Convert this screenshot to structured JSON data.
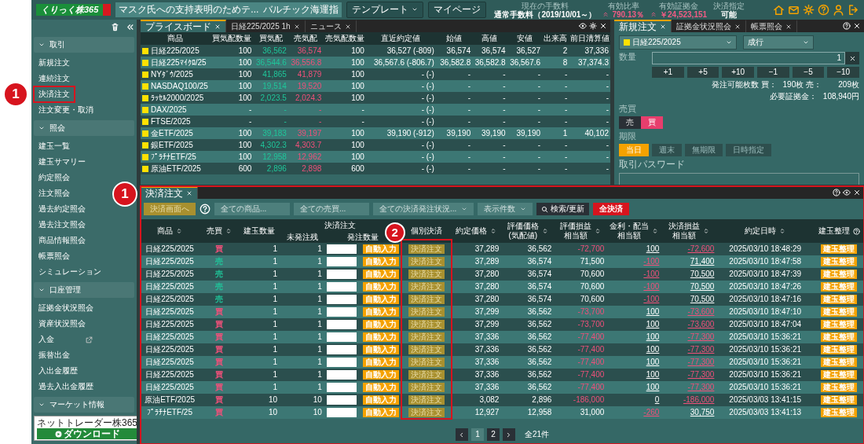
{
  "header": {
    "logo": "くりっく株365",
    "news": [
      "マスク氏への支持表明のためテ...",
      "バルチック海運指"
    ],
    "buttons": [
      {
        "label": "テンプレート",
        "dropdown": true
      },
      {
        "label": "マイページ",
        "dropdown": false
      }
    ],
    "stats": [
      {
        "label": "現在の手数料",
        "value": "通常手数料（2019/10/01～）",
        "rising": false
      },
      {
        "label": "有効比率",
        "value": "790.13％",
        "rising": true
      },
      {
        "label": "有効証拠金",
        "value": "￥24,523,151",
        "rising": true
      },
      {
        "label": "決済指定",
        "value": "可能",
        "rising": false
      }
    ]
  },
  "sidebar": {
    "sections": [
      {
        "title": "取引",
        "expanded": true,
        "items": [
          {
            "label": "新規注文"
          },
          {
            "label": "連続注文"
          },
          {
            "label": "決済注文",
            "marker": "1"
          },
          {
            "label": "注文変更・取消"
          }
        ]
      },
      {
        "title": "照会",
        "expanded": true,
        "items": [
          {
            "label": "建玉一覧"
          },
          {
            "label": "建玉サマリー"
          },
          {
            "label": "約定照会"
          },
          {
            "label": "注文照会"
          },
          {
            "label": "過去約定照会"
          },
          {
            "label": "過去注文照会"
          },
          {
            "label": "商品情報照会"
          },
          {
            "label": "帳票照会"
          },
          {
            "label": "シミュレーション"
          }
        ]
      },
      {
        "title": "口座管理",
        "expanded": true,
        "items": [
          {
            "label": "証拠金状況照会"
          },
          {
            "label": "資産状況照会"
          },
          {
            "label": "入金",
            "external": true
          },
          {
            "label": "振替出金"
          },
          {
            "label": "入出金履歴"
          },
          {
            "label": "過去入出金履歴"
          }
        ]
      },
      {
        "title": "マーケット情報",
        "expanded": true
      }
    ],
    "download": [
      "ネットトレーダー株365",
      "ダウンロード"
    ]
  },
  "price_board": {
    "tabs": [
      {
        "label": "プライスボード",
        "selected": true
      },
      {
        "label": "日経225/2025 1h",
        "selected": false
      },
      {
        "label": "ニュース",
        "selected": false
      }
    ],
    "columns": [
      "商品",
      "買気配数量",
      "買気配",
      "売気配",
      "売気配数量",
      "直近約定値",
      "始値",
      "高値",
      "安値",
      "出来高",
      "前日清算値"
    ],
    "rows": [
      [
        "日経225/2025",
        "100",
        "36,562",
        "36,574",
        "100",
        "36,527 (-809)",
        "36,574",
        "36,574",
        "36,527",
        "2",
        "37,336"
      ],
      [
        "日経225ﾏｲｸﾛ/25",
        "100",
        "36,544.6",
        "36,556.8",
        "100",
        "36,567.6 (-806.7)",
        "36,582.8",
        "36,582.8",
        "36,567.6",
        "8",
        "37,374.3"
      ],
      [
        "NYﾀﾞｳ/2025",
        "100",
        "41,865",
        "41,879",
        "100",
        "- (-)",
        "-",
        "-",
        "-",
        "-",
        "-"
      ],
      [
        "NASDAQ100/25",
        "100",
        "19,514",
        "19,520",
        "100",
        "- (-)",
        "-",
        "-",
        "-",
        "-",
        "-"
      ],
      [
        "ﾗｯｾﾙ2000/2025",
        "100",
        "2,023.5",
        "2,024.3",
        "100",
        "- (-)",
        "-",
        "-",
        "-",
        "-",
        "-"
      ],
      [
        "DAX/2025",
        "-",
        "-",
        "-",
        "-",
        "- (-)",
        "-",
        "-",
        "-",
        "-",
        "-"
      ],
      [
        "FTSE/2025",
        "-",
        "-",
        "-",
        "-",
        "- (-)",
        "-",
        "-",
        "-",
        "-",
        "-"
      ],
      [
        "金ETF/2025",
        "100",
        "39,183",
        "39,197",
        "100",
        "39,190 (-912)",
        "39,190",
        "39,190",
        "39,190",
        "1",
        "40,102"
      ],
      [
        "銀ETF/2025",
        "100",
        "4,302.3",
        "4,303.7",
        "100",
        "- (-)",
        "-",
        "-",
        "-",
        "-",
        "-"
      ],
      [
        "ﾌﾟﾗﾁﾅETF/25",
        "100",
        "12,958",
        "12,962",
        "100",
        "- (-)",
        "-",
        "-",
        "-",
        "-",
        "-"
      ],
      [
        "原油ETF/2025",
        "600",
        "2,896",
        "2,898",
        "600",
        "- (-)",
        "-",
        "-",
        "-",
        "-",
        "-"
      ]
    ]
  },
  "order_panel": {
    "tabs": [
      {
        "label": "新規注文",
        "selected": true
      },
      {
        "label": "証拠金状況照会",
        "selected": false
      },
      {
        "label": "帳票照会",
        "selected": false
      }
    ],
    "product": "日経225/2025",
    "order_type": "成行",
    "quantity_label": "数量",
    "quantity": "1",
    "steps": [
      "+1",
      "+5",
      "+10",
      "−1",
      "−5",
      "−10"
    ],
    "info": [
      [
        "発注可能枚数 買：",
        "190枚 売：",
        "209枚"
      ],
      [
        "必要証拠金：",
        "108,940円"
      ]
    ],
    "side_label": "売買",
    "sides": [
      {
        "label": "売",
        "selected": false,
        "kind": "sell"
      },
      {
        "label": "買",
        "selected": true,
        "kind": "buy"
      }
    ],
    "term_label": "期限",
    "terms": [
      {
        "label": "当日",
        "selected": true
      },
      {
        "label": "週末",
        "selected": false
      },
      {
        "label": "無期限",
        "selected": false
      },
      {
        "label": "日時指定",
        "selected": false
      }
    ],
    "password_label": "取引パスワード"
  },
  "settlement": {
    "tab": "決済注文",
    "marker": "1",
    "toolbar": [
      {
        "kind": "gold",
        "label": "決済画面へ"
      },
      {
        "kind": "help"
      },
      {
        "kind": "filter",
        "label": "全ての商品..."
      },
      {
        "kind": "filter",
        "label": "全ての売買..."
      },
      {
        "kind": "dropdown",
        "label": "全ての決済発注状況..."
      },
      {
        "kind": "dropdown",
        "label": "表示件数"
      },
      {
        "kind": "search",
        "label": "検索/更新"
      },
      {
        "kind": "danger",
        "label": "全決済"
      }
    ],
    "group_header": "決済注文",
    "columns": [
      {
        "lines": [
          "商品"
        ],
        "sortable": true
      },
      {
        "lines": [
          "売買"
        ],
        "sortable": true
      },
      {
        "lines": [
          "建玉数量"
        ],
        "sortable": false
      },
      {
        "lines": [
          "未発注残"
        ],
        "sortable": false
      },
      {
        "lines": [
          "発注数量"
        ],
        "sortable": false
      },
      {
        "lines": [
          "個別決済"
        ],
        "sortable": false,
        "marker": "2"
      },
      {
        "lines": [
          "約定価格"
        ],
        "sortable": true
      },
      {
        "lines": [
          "評価価格",
          "(気配値)"
        ],
        "sortable": true
      },
      {
        "lines": [
          "評価損益",
          "相当額"
        ],
        "sortable": true
      },
      {
        "lines": [
          "金利・配当",
          "相当額"
        ],
        "sortable": true
      },
      {
        "lines": [
          "決済損益",
          "相当額"
        ],
        "sortable": true
      },
      {
        "lines": [
          "約定日時"
        ],
        "sortable": true
      },
      {
        "lines": [
          "建玉整理"
        ],
        "sortable": false,
        "help": true
      }
    ],
    "rows": [
      {
        "product": "日経225/2025",
        "side": {
          "label": "買",
          "kind": "buy"
        },
        "qty": "1",
        "remaining": "1",
        "auto": "自動入力",
        "close": "決済注文",
        "price": "37,289",
        "eval": "36,562",
        "pnl": "-72,700",
        "pnl_negative": true,
        "interest": "100",
        "interest_negative": false,
        "settle": "-72,600",
        "settle_negative": true,
        "time": "2025/03/10 18:48:29",
        "tidy": "建玉整理"
      },
      {
        "product": "日経225/2025",
        "side": {
          "label": "売",
          "kind": "sell"
        },
        "qty": "1",
        "remaining": "1",
        "auto": "自動入力",
        "close": "決済注文",
        "price": "37,289",
        "eval": "36,574",
        "pnl": "71,500",
        "pnl_negative": false,
        "interest": "-100",
        "interest_negative": true,
        "settle": "71,400",
        "settle_negative": false,
        "time": "2025/03/10 18:47:58",
        "tidy": "建玉整理"
      },
      {
        "product": "日経225/2025",
        "side": {
          "label": "売",
          "kind": "sell"
        },
        "qty": "1",
        "remaining": "1",
        "auto": "自動入力",
        "close": "決済注文",
        "price": "37,280",
        "eval": "36,574",
        "pnl": "70,600",
        "pnl_negative": false,
        "interest": "-100",
        "interest_negative": true,
        "settle": "70,500",
        "settle_negative": false,
        "time": "2025/03/10 18:47:39",
        "tidy": "建玉整理"
      },
      {
        "product": "日経225/2025",
        "side": {
          "label": "売",
          "kind": "sell"
        },
        "qty": "1",
        "remaining": "1",
        "auto": "自動入力",
        "close": "決済注文",
        "price": "37,280",
        "eval": "36,574",
        "pnl": "70,600",
        "pnl_negative": false,
        "interest": "-100",
        "interest_negative": true,
        "settle": "70,500",
        "settle_negative": false,
        "time": "2025/03/10 18:47:26",
        "tidy": "建玉整理"
      },
      {
        "product": "日経225/2025",
        "side": {
          "label": "売",
          "kind": "sell"
        },
        "qty": "1",
        "remaining": "1",
        "auto": "自動入力",
        "close": "決済注文",
        "price": "37,280",
        "eval": "36,574",
        "pnl": "70,600",
        "pnl_negative": false,
        "interest": "-100",
        "interest_negative": true,
        "settle": "70,500",
        "settle_negative": false,
        "time": "2025/03/10 18:47:16",
        "tidy": "建玉整理"
      },
      {
        "product": "日経225/2025",
        "side": {
          "label": "買",
          "kind": "buy"
        },
        "qty": "1",
        "remaining": "1",
        "auto": "自動入力",
        "close": "決済注文",
        "price": "37,299",
        "eval": "36,562",
        "pnl": "-73,700",
        "pnl_negative": true,
        "interest": "100",
        "interest_negative": false,
        "settle": "-73,600",
        "settle_negative": true,
        "time": "2025/03/10 18:47:10",
        "tidy": "建玉整理"
      },
      {
        "product": "日経225/2025",
        "side": {
          "label": "買",
          "kind": "buy"
        },
        "qty": "1",
        "remaining": "1",
        "auto": "自動入力",
        "close": "決済注文",
        "price": "37,299",
        "eval": "36,562",
        "pnl": "-73,700",
        "pnl_negative": true,
        "interest": "100",
        "interest_negative": false,
        "settle": "-73,600",
        "settle_negative": true,
        "time": "2025/03/10 18:47:04",
        "tidy": "建玉整理"
      },
      {
        "product": "日経225/2025",
        "side": {
          "label": "買",
          "kind": "buy"
        },
        "qty": "1",
        "remaining": "1",
        "auto": "自動入力",
        "close": "決済注文",
        "price": "37,336",
        "eval": "36,562",
        "pnl": "-77,400",
        "pnl_negative": true,
        "interest": "100",
        "interest_negative": false,
        "settle": "-77,300",
        "settle_negative": true,
        "time": "2025/03/10 15:36:21",
        "tidy": "建玉整理"
      },
      {
        "product": "日経225/2025",
        "side": {
          "label": "買",
          "kind": "buy"
        },
        "qty": "1",
        "remaining": "1",
        "auto": "自動入力",
        "close": "決済注文",
        "price": "37,336",
        "eval": "36,562",
        "pnl": "-77,400",
        "pnl_negative": true,
        "interest": "100",
        "interest_negative": false,
        "settle": "-77,300",
        "settle_negative": true,
        "time": "2025/03/10 15:36:21",
        "tidy": "建玉整理"
      },
      {
        "product": "日経225/2025",
        "side": {
          "label": "買",
          "kind": "buy"
        },
        "qty": "1",
        "remaining": "1",
        "auto": "自動入力",
        "close": "決済注文",
        "price": "37,336",
        "eval": "36,562",
        "pnl": "-77,400",
        "pnl_negative": true,
        "interest": "100",
        "interest_negative": false,
        "settle": "-77,300",
        "settle_negative": true,
        "time": "2025/03/10 15:36:21",
        "tidy": "建玉整理"
      },
      {
        "product": "日経225/2025",
        "side": {
          "label": "買",
          "kind": "buy"
        },
        "qty": "1",
        "remaining": "1",
        "auto": "自動入力",
        "close": "決済注文",
        "price": "37,336",
        "eval": "36,562",
        "pnl": "-77,400",
        "pnl_negative": true,
        "interest": "100",
        "interest_negative": false,
        "settle": "-77,300",
        "settle_negative": true,
        "time": "2025/03/10 15:36:21",
        "tidy": "建玉整理"
      },
      {
        "product": "日経225/2025",
        "side": {
          "label": "買",
          "kind": "buy"
        },
        "qty": "1",
        "remaining": "1",
        "auto": "自動入力",
        "close": "決済注文",
        "price": "37,336",
        "eval": "36,562",
        "pnl": "-77,400",
        "pnl_negative": true,
        "interest": "100",
        "interest_negative": false,
        "settle": "-77,300",
        "settle_negative": true,
        "time": "2025/03/10 15:36:21",
        "tidy": "建玉整理"
      },
      {
        "product": "原油ETF/2025",
        "side": {
          "label": "買",
          "kind": "buy"
        },
        "qty": "10",
        "remaining": "10",
        "auto": "自動入力",
        "close": "決済注文",
        "price": "3,082",
        "eval": "2,896",
        "pnl": "-186,000",
        "pnl_negative": true,
        "interest": "0",
        "interest_negative": false,
        "settle": "-186,000",
        "settle_negative": true,
        "time": "2025/03/03 13:41:15",
        "tidy": "建玉整理"
      },
      {
        "product": "ﾌﾟﾗﾁﾅETF/25",
        "side": {
          "label": "買",
          "kind": "buy"
        },
        "qty": "10",
        "remaining": "10",
        "auto": "自動入力",
        "close": "決済注文",
        "price": "12,927",
        "eval": "12,958",
        "pnl": "31,000",
        "pnl_negative": false,
        "interest": "-260",
        "interest_negative": true,
        "settle": "30,750",
        "settle_negative": false,
        "time": "2025/03/03 13:41:13",
        "tidy": "建玉整理"
      }
    ],
    "pages": [
      {
        "label": "1",
        "selected": true
      },
      {
        "label": "2",
        "selected": false
      }
    ],
    "total": "全21件"
  }
}
